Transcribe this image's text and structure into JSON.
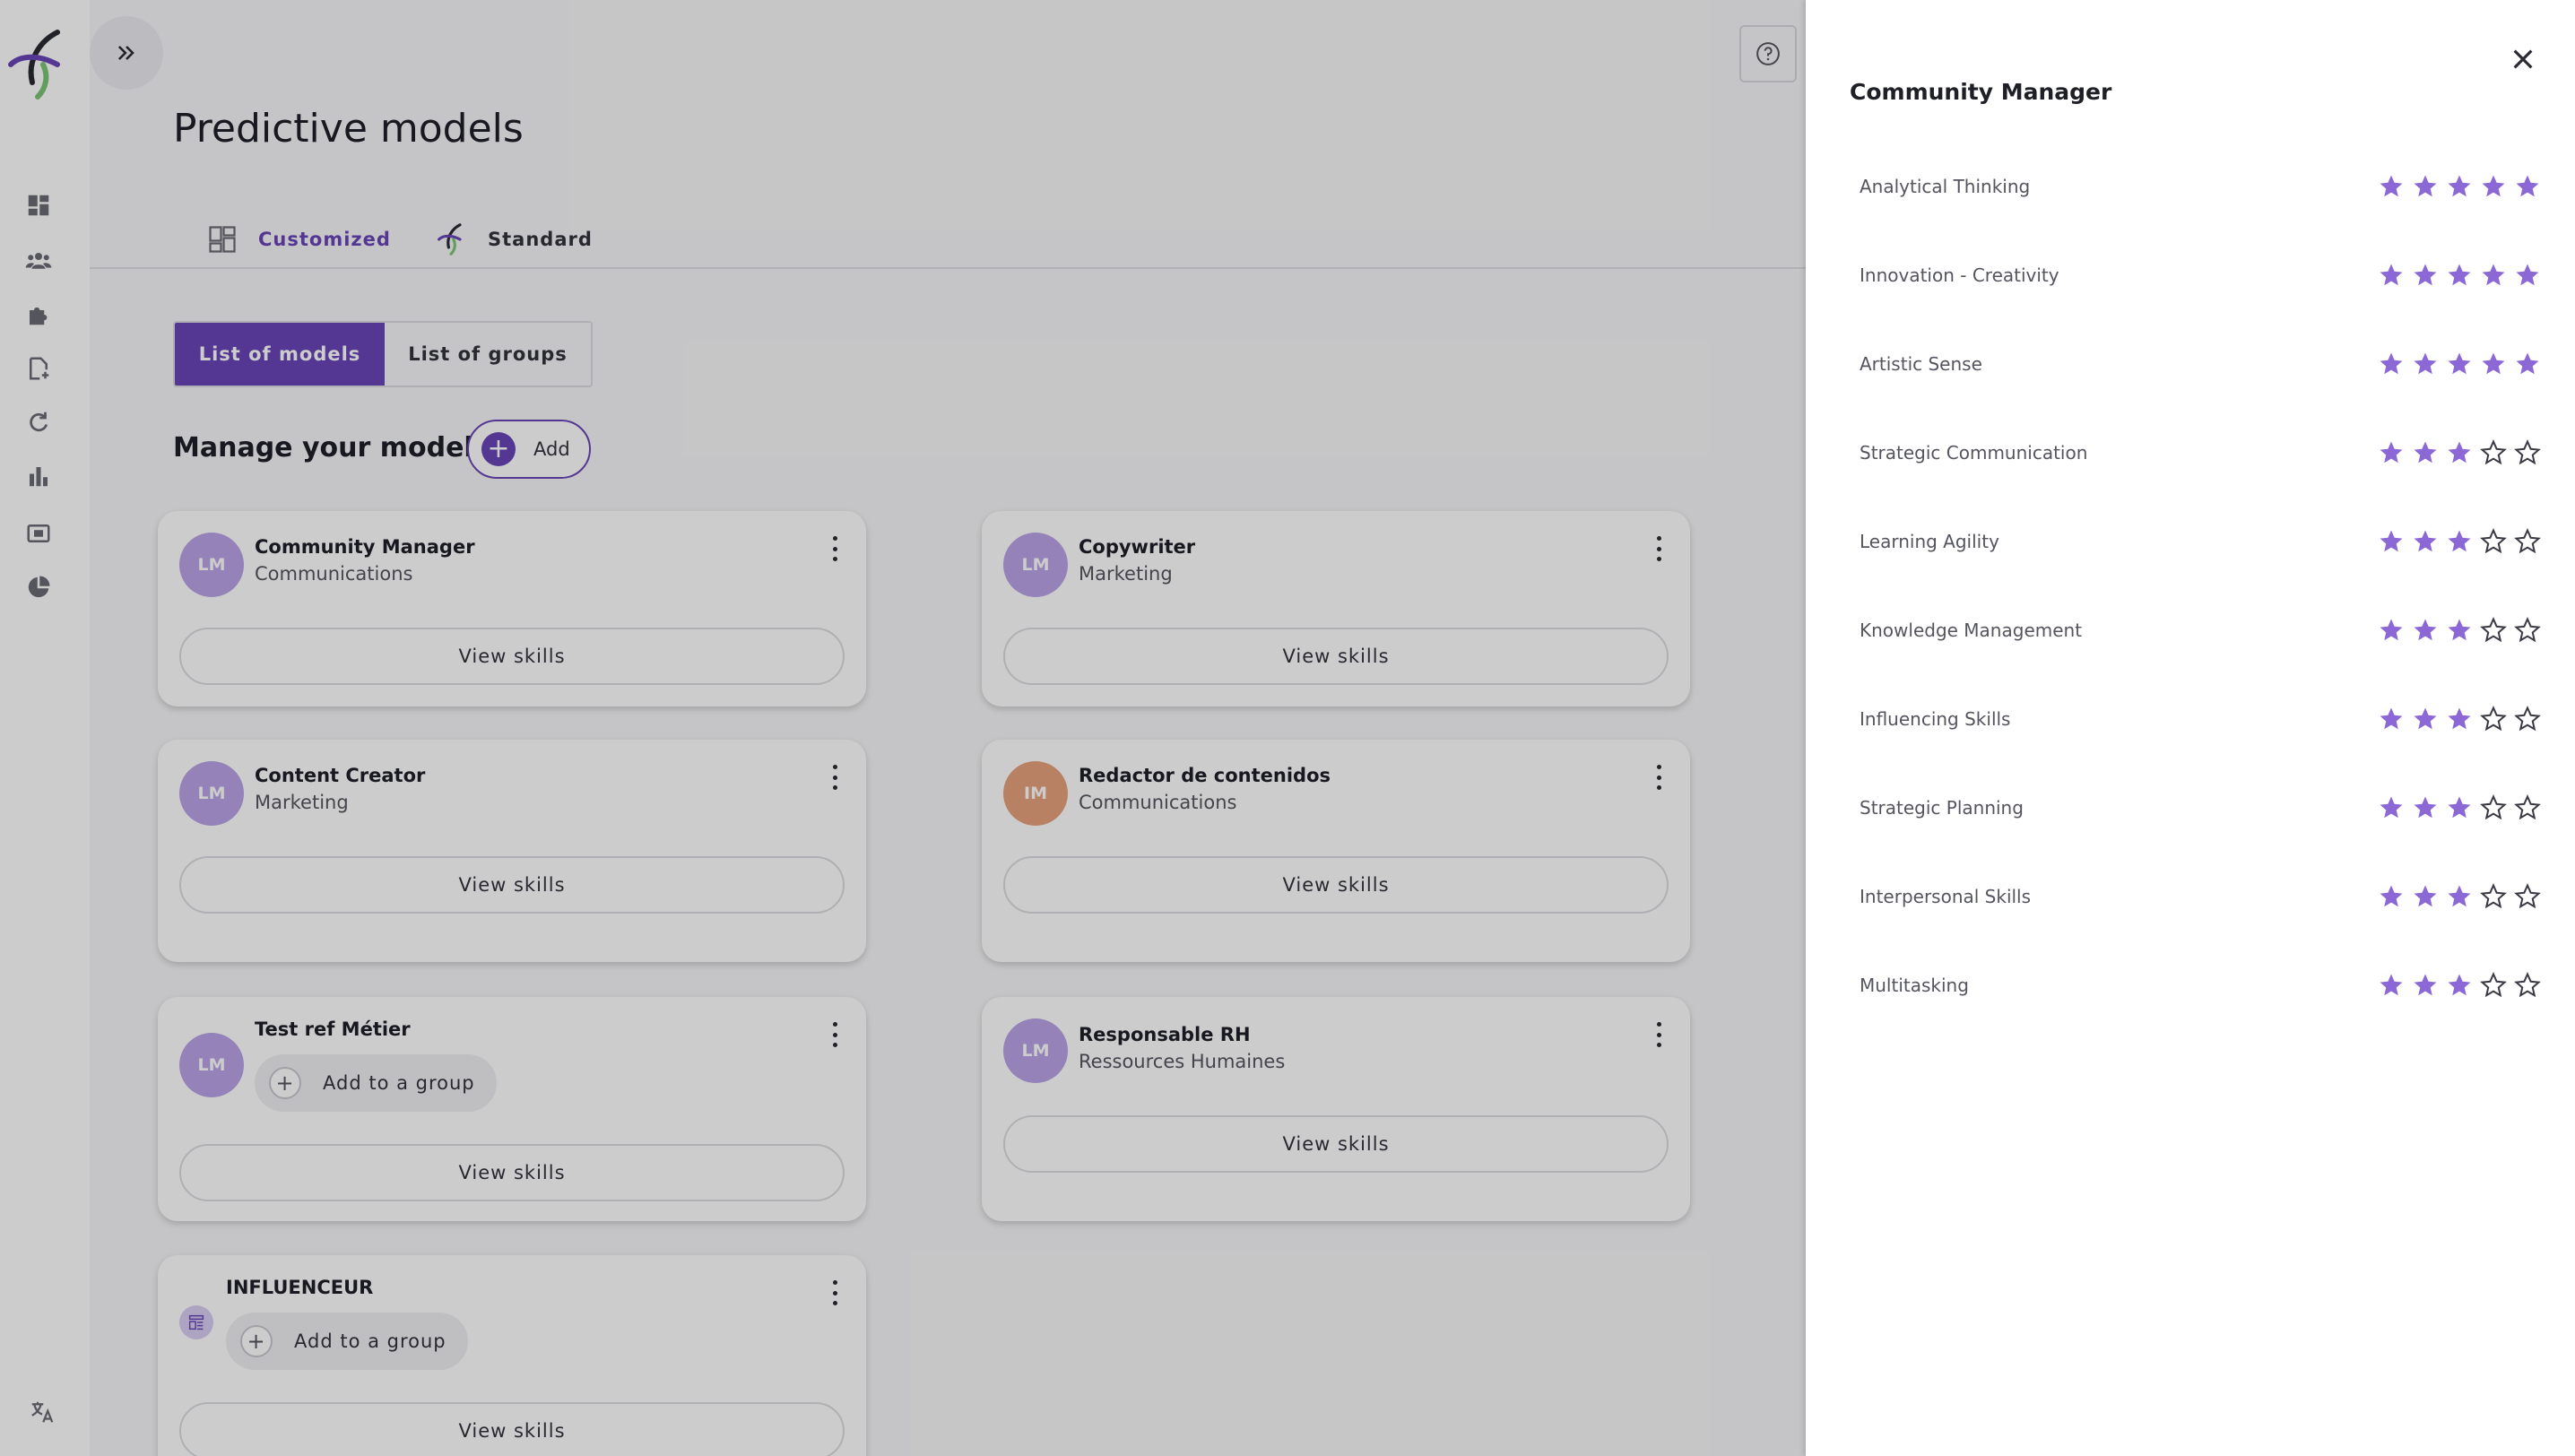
{
  "nav": {
    "icons": [
      "dashboard-icon",
      "people-icon",
      "puzzle-icon",
      "document-add-icon",
      "refresh-icon",
      "bar-chart-icon",
      "id-card-icon",
      "pie-chart-icon",
      "translate-icon"
    ]
  },
  "header": {
    "title": "Predictive models"
  },
  "tabs": [
    {
      "label": "Customized",
      "active": true
    },
    {
      "label": "Standard",
      "active": false
    }
  ],
  "segment": {
    "models_label": "List of models",
    "groups_label": "List of groups"
  },
  "manage": {
    "title": "Manage your models",
    "add_label": "Add"
  },
  "cards": [
    {
      "initials": "LM",
      "name": "Community Manager",
      "sub": "Communications",
      "view_label": "View skills"
    },
    {
      "initials": "LM",
      "name": "Copywriter",
      "sub": "Marketing",
      "view_label": "View skills"
    },
    {
      "initials": "LM",
      "name": "Content Creator",
      "sub": "Marketing",
      "view_label": "View skills"
    },
    {
      "initials": "IM",
      "name": "Redactor de contenidos",
      "sub": "Communications",
      "view_label": "View skills"
    },
    {
      "initials": "LM",
      "name": "Test ref Métier",
      "group_label": "Add to a group",
      "view_label": "View skills"
    },
    {
      "initials": "LM",
      "name": "Responsable RH",
      "sub": "Ressources Humaines",
      "view_label": "View skills"
    },
    {
      "name": "INFLUENCEUR",
      "group_label": "Add to a group",
      "view_label": "View skills"
    }
  ],
  "drawer": {
    "title": "Community Manager",
    "skills": [
      {
        "name": "Analytical Thinking",
        "rating": 5
      },
      {
        "name": "Innovation - Creativity",
        "rating": 5
      },
      {
        "name": "Artistic Sense",
        "rating": 5
      },
      {
        "name": "Strategic Communication",
        "rating": 3
      },
      {
        "name": "Learning Agility",
        "rating": 3
      },
      {
        "name": "Knowledge Management",
        "rating": 3
      },
      {
        "name": "Influencing Skills",
        "rating": 3
      },
      {
        "name": "Strategic Planning",
        "rating": 3
      },
      {
        "name": "Interpersonal Skills",
        "rating": 3
      },
      {
        "name": "Multitasking",
        "rating": 3
      }
    ],
    "max_rating": 5
  },
  "colors": {
    "accent": "#6a45b8",
    "star": "#8b68d6",
    "avatar_purple": "#b9a3e6",
    "avatar_orange": "#e8a27c"
  }
}
